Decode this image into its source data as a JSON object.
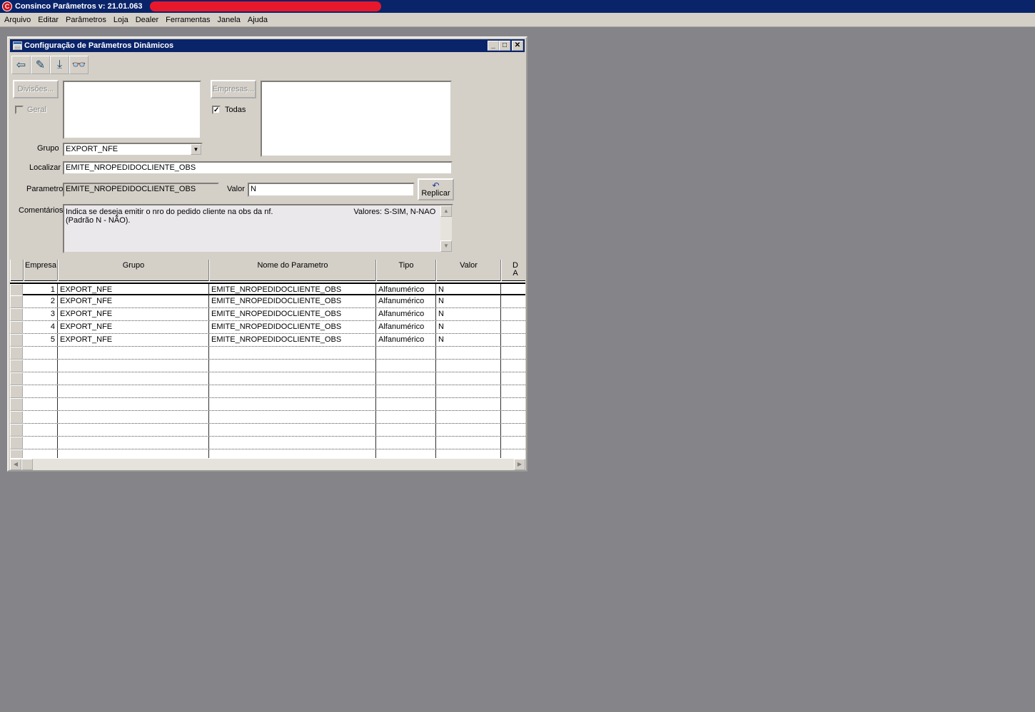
{
  "app": {
    "title": "Consinco Parâmetros  v: 21.01.063",
    "icon_letter": "C"
  },
  "menu": [
    "Arquivo",
    "Editar",
    "Parâmetros",
    "Loja",
    "Dealer",
    "Ferramentas",
    "Janela",
    "Ajuda"
  ],
  "window": {
    "title": "Configuração de Parâmetros Dinâmicos",
    "controls": {
      "minimize": "_",
      "maximize": "□",
      "close": "✕"
    }
  },
  "toolbar": [
    {
      "name": "exit-icon",
      "glyph": "⇦"
    },
    {
      "name": "pencil-icon",
      "glyph": "✎"
    },
    {
      "name": "save-icon",
      "glyph": "⤓"
    },
    {
      "name": "binoculars-icon",
      "glyph": "👓"
    }
  ],
  "form": {
    "divisoes_label": "Divisões...",
    "geral_label": "Geral",
    "empresas_label": "Empresas...",
    "todas_label": "Todas",
    "todas_checked": "✓",
    "grupo_label": "Grupo",
    "grupo_value": "EXPORT_NFE",
    "localizar_label": "Localizar",
    "localizar_value": "EMITE_NROPEDIDOCLIENTE_OBS",
    "parametro_label": "Parametro",
    "parametro_value": "EMITE_NROPEDIDOCLIENTE_OBS",
    "valor_label": "Valor",
    "valor_value": "N",
    "replicar_label": "Replicar",
    "replicar_icon": "↶",
    "comentarios_label": "Comentários",
    "comentarios_text": "Indica se deseja emitir o nro do pedido cliente na obs da nf.                                     Valores: S-SIM, N-NAO (Padrão N - NÃO)."
  },
  "grid": {
    "columns": [
      "Empresa",
      "Grupo",
      "Nome do Parametro",
      "Tipo",
      "Valor",
      "D\nA"
    ],
    "rows": [
      [
        "1",
        "EXPORT_NFE",
        "EMITE_NROPEDIDOCLIENTE_OBS",
        "Alfanumérico",
        "N"
      ],
      [
        "2",
        "EXPORT_NFE",
        "EMITE_NROPEDIDOCLIENTE_OBS",
        "Alfanumérico",
        "N"
      ],
      [
        "3",
        "EXPORT_NFE",
        "EMITE_NROPEDIDOCLIENTE_OBS",
        "Alfanumérico",
        "N"
      ],
      [
        "4",
        "EXPORT_NFE",
        "EMITE_NROPEDIDOCLIENTE_OBS",
        "Alfanumérico",
        "N"
      ],
      [
        "5",
        "EXPORT_NFE",
        "EMITE_NROPEDIDOCLIENTE_OBS",
        "Alfanumérico",
        "N"
      ]
    ],
    "empty_rows": 9
  },
  "colors": {
    "titlebar": "#0a246a",
    "face": "#d4d0c8",
    "desktop": "#858489",
    "redaction": "#e8182c"
  }
}
